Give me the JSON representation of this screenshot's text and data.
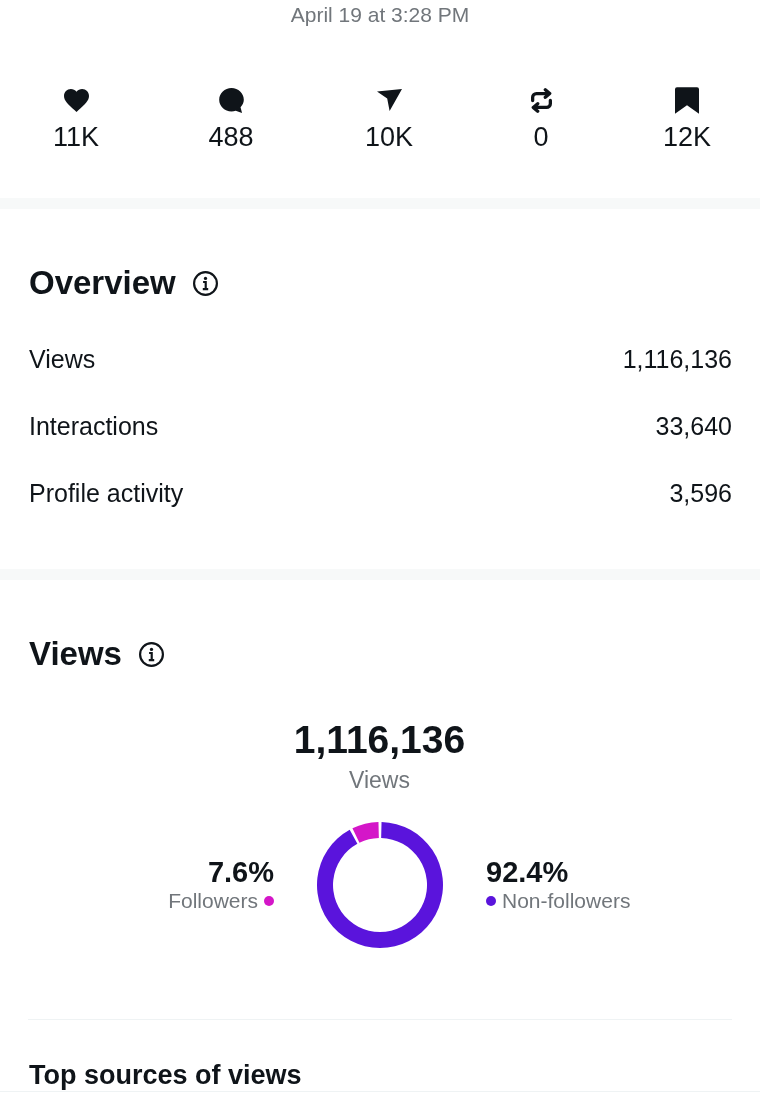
{
  "timestamp": "April 19 at 3:28 PM",
  "stats": [
    {
      "count": "11K"
    },
    {
      "count": "488"
    },
    {
      "count": "10K"
    },
    {
      "count": "0"
    },
    {
      "count": "12K"
    }
  ],
  "overview": {
    "title": "Overview",
    "rows": [
      {
        "label": "Views",
        "value": "1,116,136"
      },
      {
        "label": "Interactions",
        "value": "33,640"
      },
      {
        "label": "Profile activity",
        "value": "3,596"
      }
    ]
  },
  "views": {
    "title": "Views",
    "total": "1,116,136",
    "total_label": "Views",
    "legend": [
      {
        "percent": "7.6%",
        "label": "Followers",
        "color": "#d416c8"
      },
      {
        "percent": "92.4%",
        "label": "Non-followers",
        "color": "#5a14dc"
      }
    ],
    "chart_data": {
      "type": "donut",
      "values": [
        7.6,
        92.4
      ]
    }
  },
  "top_sources": {
    "title": "Top sources of views"
  }
}
